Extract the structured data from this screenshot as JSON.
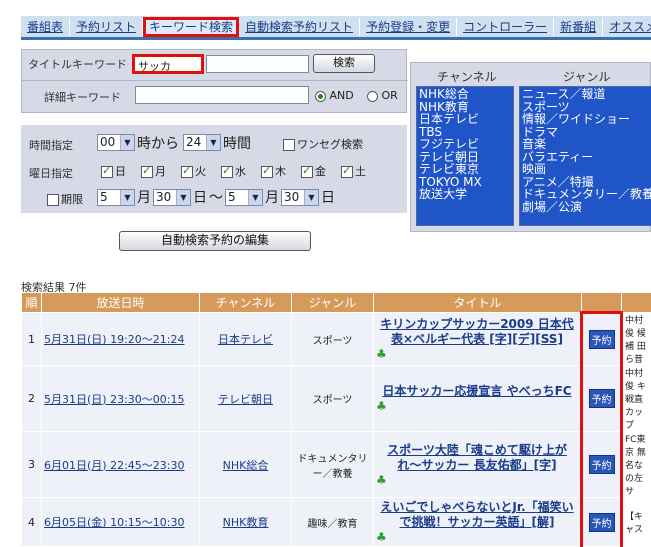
{
  "nav": {
    "items": [
      {
        "label": "番組表",
        "active": false
      },
      {
        "label": "予約リスト",
        "active": false
      },
      {
        "label": "キーワード検索",
        "active": true
      },
      {
        "label": "自動検索予約リスト",
        "active": false
      },
      {
        "label": "予約登録・変更",
        "active": false
      },
      {
        "label": "コントローラー",
        "active": false
      },
      {
        "label": "新番組",
        "active": false
      },
      {
        "label": "オススメ",
        "active": false
      }
    ]
  },
  "search": {
    "title_label": "タイトルキーワード",
    "title_value": "サッカ",
    "search_button": "検索",
    "detail_label": "詳細キーワード",
    "detail_value": "",
    "and_label": "AND",
    "or_label": "OR"
  },
  "filters": {
    "time_label": "時間指定",
    "time_from": "00",
    "from_text": "時から",
    "time_to": "24",
    "to_text": "時間",
    "oneseg_label": "ワンセグ検索",
    "day_label": "曜日指定",
    "days": [
      "日",
      "月",
      "火",
      "水",
      "木",
      "金",
      "土"
    ],
    "period_label": "期限",
    "month1": "5",
    "day1": "30",
    "month2": "5",
    "day2": "30",
    "month_text": "月",
    "day_text": "日",
    "tilde": "〜",
    "edit_button": "自動検索予約の編集"
  },
  "channels": {
    "header": "チャンネル",
    "items": [
      "NHK総合",
      "NHK教育",
      "日本テレビ",
      "TBS",
      "フジテレビ",
      "テレビ朝日",
      "テレビ東京",
      "TOKYO MX",
      "放送大学"
    ]
  },
  "genres": {
    "header": "ジャンル",
    "items": [
      "ニュース／報道",
      "スポーツ",
      "情報／ワイドショー",
      "ドラマ",
      "音楽",
      "バラエティー",
      "映画",
      "アニメ／特撮",
      "ドキュメンタリー／教養",
      "劇場／公演"
    ]
  },
  "results": {
    "count_label": "検索結果 7件",
    "headers": [
      "順",
      "放送日時",
      "チャンネル",
      "ジャンル",
      "タイトル",
      "",
      ""
    ],
    "reserve_label": "予約",
    "rows": [
      {
        "num": "1",
        "datetime": "5月31日(日) 19:20〜21:24",
        "channel": "日本テレビ",
        "genre": "スポーツ",
        "title": "キリンカップサッカー2009 日本代表×ベルギー代表 [字][デ][SS]",
        "note": "中村俊 候補 田 ら昔"
      },
      {
        "num": "2",
        "datetime": "5月31日(日) 23:30〜00:15",
        "channel": "テレビ朝日",
        "genre": "スポーツ",
        "title": "日本サッカー応援宣言 やべっちFC",
        "note": "中村俊 キ戦直 カップ"
      },
      {
        "num": "3",
        "datetime": "6月01日(月) 22:45〜23:30",
        "channel": "NHK総合",
        "genre": "ドキュメンタリー／教養",
        "title": "スポーツ大陸「魂こめて駆け上がれ〜サッカー 長友佑都」[字]",
        "note": "FC東京 無名な の左サ"
      },
      {
        "num": "4",
        "datetime": "6月05日(金) 10:15〜10:30",
        "channel": "NHK教育",
        "genre": "趣味／教育",
        "title": "えいごでしゃべらないとJr.「福笑いで挑戦！サッカー英語」[解]",
        "note": "【キャス"
      }
    ]
  }
}
